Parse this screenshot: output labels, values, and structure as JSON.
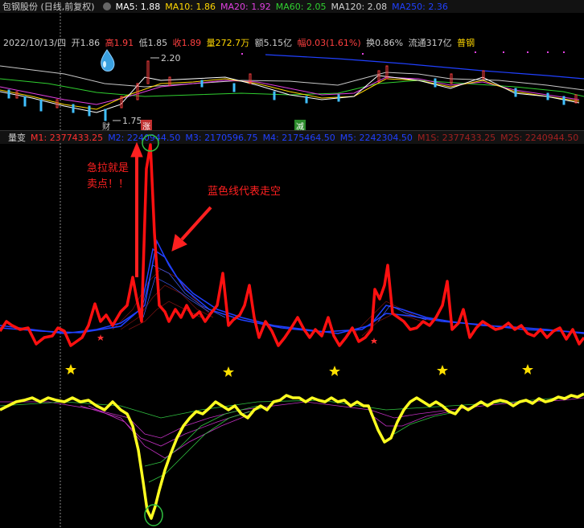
{
  "header": {
    "title": "包钢股份 (日线,前复权)",
    "ma": [
      {
        "label": "MA5: 1.88",
        "color": "#ffffff"
      },
      {
        "label": "MA10: 1.86",
        "color": "#ffd700"
      },
      {
        "label": "MA20: 1.92",
        "color": "#e040e0"
      },
      {
        "label": "MA60: 2.05",
        "color": "#30d030"
      },
      {
        "label": "MA120: 2.08",
        "color": "#d0d0d0"
      },
      {
        "label": "MA250: 2.36",
        "color": "#2040ff"
      }
    ]
  },
  "quote": {
    "date": "2022/10/13/四",
    "open": "开1.86",
    "high": "高1.91",
    "low": "低1.85",
    "close": "收1.89",
    "volume": "量272.7万",
    "amount": "额5.15亿",
    "amplitude": "幅0.03(1.61%)",
    "turnover": "换0.86%",
    "float": "流通317亿",
    "sector": "普钢"
  },
  "price_chart": {
    "high_label": "2.20",
    "low_label": "1.75",
    "tags": [
      "财",
      "涨",
      "减"
    ]
  },
  "indicator": {
    "name": "量变",
    "values": [
      {
        "label": "M1: 2377433.25",
        "color": "#ff3030"
      },
      {
        "label": "M2: 2240944.50",
        "color": "#2040ff"
      },
      {
        "label": "M3: 2170596.75",
        "color": "#2040ff"
      },
      {
        "label": "M4: 2175464.50",
        "color": "#2040ff"
      },
      {
        "label": "M5: 2242304.50",
        "color": "#2040ff"
      },
      {
        "label": "M1S: 2377433.25",
        "color": "#a02020"
      },
      {
        "label": "M2S: 2240944.50",
        "color": "#a02020"
      },
      {
        "label": "M3",
        "color": "#a02020"
      }
    ]
  },
  "annotations": {
    "sell": "急拉就是卖点！！",
    "blue": "蓝色线代表走空"
  }
}
